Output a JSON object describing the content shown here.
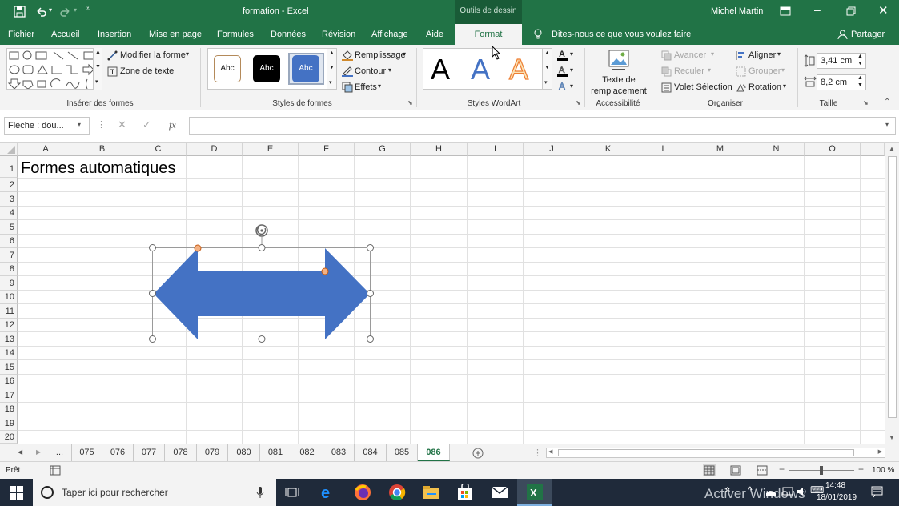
{
  "app": {
    "doc_title": "formation  -  Excel",
    "context_tab_group": "Outils de dessin",
    "user": "Michel Martin",
    "accent": "#217346"
  },
  "tabs": [
    "Fichier",
    "Accueil",
    "Insertion",
    "Mise en page",
    "Formules",
    "Données",
    "Révision",
    "Affichage",
    "Aide",
    "Format"
  ],
  "tell_me": "Dites-nous ce que vous voulez faire",
  "share": "Partager",
  "ribbon": {
    "insert_shapes": {
      "label": "Insérer des formes",
      "edit_shape": "Modifier la forme",
      "text_box": "Zone de texte"
    },
    "shape_styles": {
      "label": "Styles de formes",
      "style_sample": "Abc",
      "fill": "Remplissage",
      "outline": "Contour",
      "effects": "Effets"
    },
    "wordart": {
      "label": "Styles WordArt",
      "sample": "A"
    },
    "accessibility": {
      "label": "Accessibilité",
      "alt_text_1": "Texte de",
      "alt_text_2": "remplacement"
    },
    "arrange": {
      "label": "Organiser",
      "bring_forward": "Avancer",
      "send_backward": "Reculer",
      "selection_pane": "Volet Sélection",
      "align": "Aligner",
      "group": "Grouper",
      "rotate": "Rotation"
    },
    "size": {
      "label": "Taille",
      "height": "3,41 cm",
      "width": "8,2 cm"
    }
  },
  "formula_bar": {
    "name_box": "Flèche : dou...",
    "fx": "fx",
    "formula": ""
  },
  "grid": {
    "columns": [
      "A",
      "B",
      "C",
      "D",
      "E",
      "F",
      "G",
      "H",
      "I",
      "J",
      "K",
      "L",
      "M",
      "N",
      "O"
    ],
    "rows": [
      "1",
      "2",
      "3",
      "4",
      "5",
      "6",
      "7",
      "8",
      "9",
      "10",
      "11",
      "12",
      "13",
      "14",
      "15",
      "16",
      "17",
      "18",
      "19",
      "20"
    ],
    "a1_text": "Formes automatiques",
    "shape_color": "#4472c4"
  },
  "sheets": {
    "ellipsis": "...",
    "tabs": [
      "075",
      "076",
      "077",
      "078",
      "079",
      "080",
      "081",
      "082",
      "083",
      "084",
      "085",
      "086"
    ],
    "active": "086"
  },
  "status": {
    "mode": "Prêt",
    "zoom": "100 %"
  },
  "taskbar": {
    "search": "Taper ici pour rechercher",
    "time": "14:48",
    "date": "18/01/2019",
    "watermark": "Activer Windows"
  }
}
